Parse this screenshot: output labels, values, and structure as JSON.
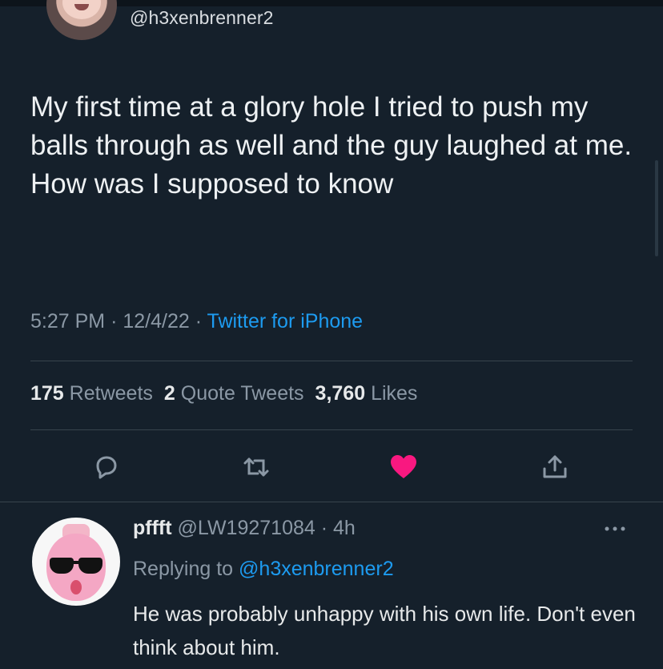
{
  "tweet": {
    "handle": "@h3xenbrenner2",
    "text": "My first time at a glory hole I tried to push my balls through as well and the guy laughed at me. How was I supposed to know",
    "time": "5:27 PM",
    "date": "12/4/22",
    "separator": "·",
    "source": "Twitter for iPhone"
  },
  "stats": {
    "retweets_count": "175",
    "retweets_label": "Retweets",
    "quotes_count": "2",
    "quotes_label": "Quote Tweets",
    "likes_count": "3,760",
    "likes_label": "Likes"
  },
  "actions": {
    "icons": [
      "reply-icon",
      "retweet-icon",
      "like-icon",
      "share-icon"
    ],
    "like_color": "#f91880",
    "icon_color": "#8b98a5"
  },
  "reply": {
    "name": "pffft",
    "handle": "@LW19271084",
    "separator": "·",
    "age": "4h",
    "replying_prefix": "Replying to",
    "replying_to": "@h3xenbrenner2",
    "text": "He was probably unhappy with his own life. Don't even think about him."
  },
  "colors": {
    "background": "#15202b",
    "link": "#1d9bf0",
    "muted": "#8b98a5",
    "text": "#e7e9ea"
  }
}
